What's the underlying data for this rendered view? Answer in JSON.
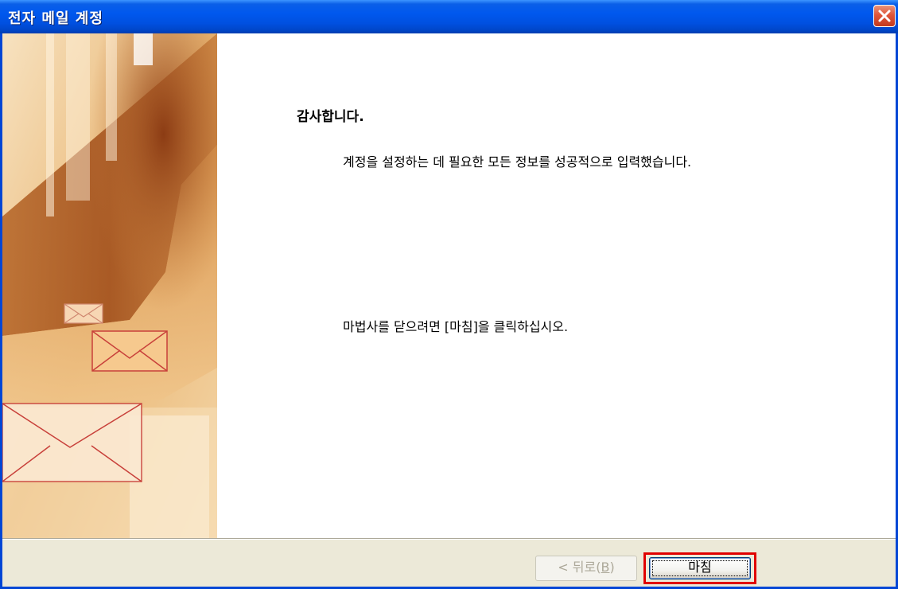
{
  "window": {
    "title": "전자 메일 계정",
    "close_icon": "close-icon",
    "accent_color": "#0054E3",
    "close_color": "#E0563A"
  },
  "main": {
    "heading": "감사합니다.",
    "message": "계정을 설정하는 데 필요한 모든 정보를 성공적으로 입력했습니다.",
    "instruction": "마법사를 닫으려면 [마침]을 클릭하십시오."
  },
  "side_image": {
    "icon": "envelope-icon"
  },
  "footer": {
    "back_label_prefix": "< 뒤로(",
    "back_label_accel": "B",
    "back_label_suffix": ")",
    "back_enabled": false,
    "finish_label": "마침",
    "highlight_color": "#E00000"
  }
}
